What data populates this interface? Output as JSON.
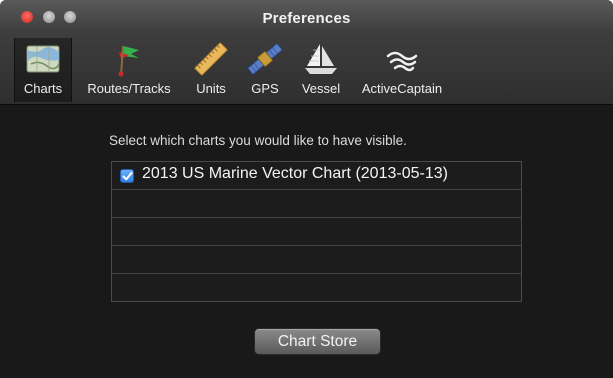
{
  "window": {
    "title": "Preferences"
  },
  "toolbar": {
    "items": [
      {
        "label": "Charts",
        "icon": "chart-map-icon",
        "selected": true
      },
      {
        "label": "Routes/Tracks",
        "icon": "flag-icon",
        "selected": false
      },
      {
        "label": "Units",
        "icon": "ruler-icon",
        "selected": false
      },
      {
        "label": "GPS",
        "icon": "satellite-icon",
        "selected": false
      },
      {
        "label": "Vessel",
        "icon": "sailboat-icon",
        "selected": false
      },
      {
        "label": "ActiveCaptain",
        "icon": "waves-icon",
        "selected": false
      }
    ]
  },
  "charts_pane": {
    "instruction": "Select which charts you would like to have visible.",
    "charts": [
      {
        "name": "2013 US Marine Vector Chart (2013-05-13)",
        "checked": true
      }
    ],
    "store_button_label": "Chart Store"
  },
  "colors": {
    "background": "#1a1a1a",
    "accent_check": "#2f7ee0",
    "close_button": "#e0443b"
  }
}
